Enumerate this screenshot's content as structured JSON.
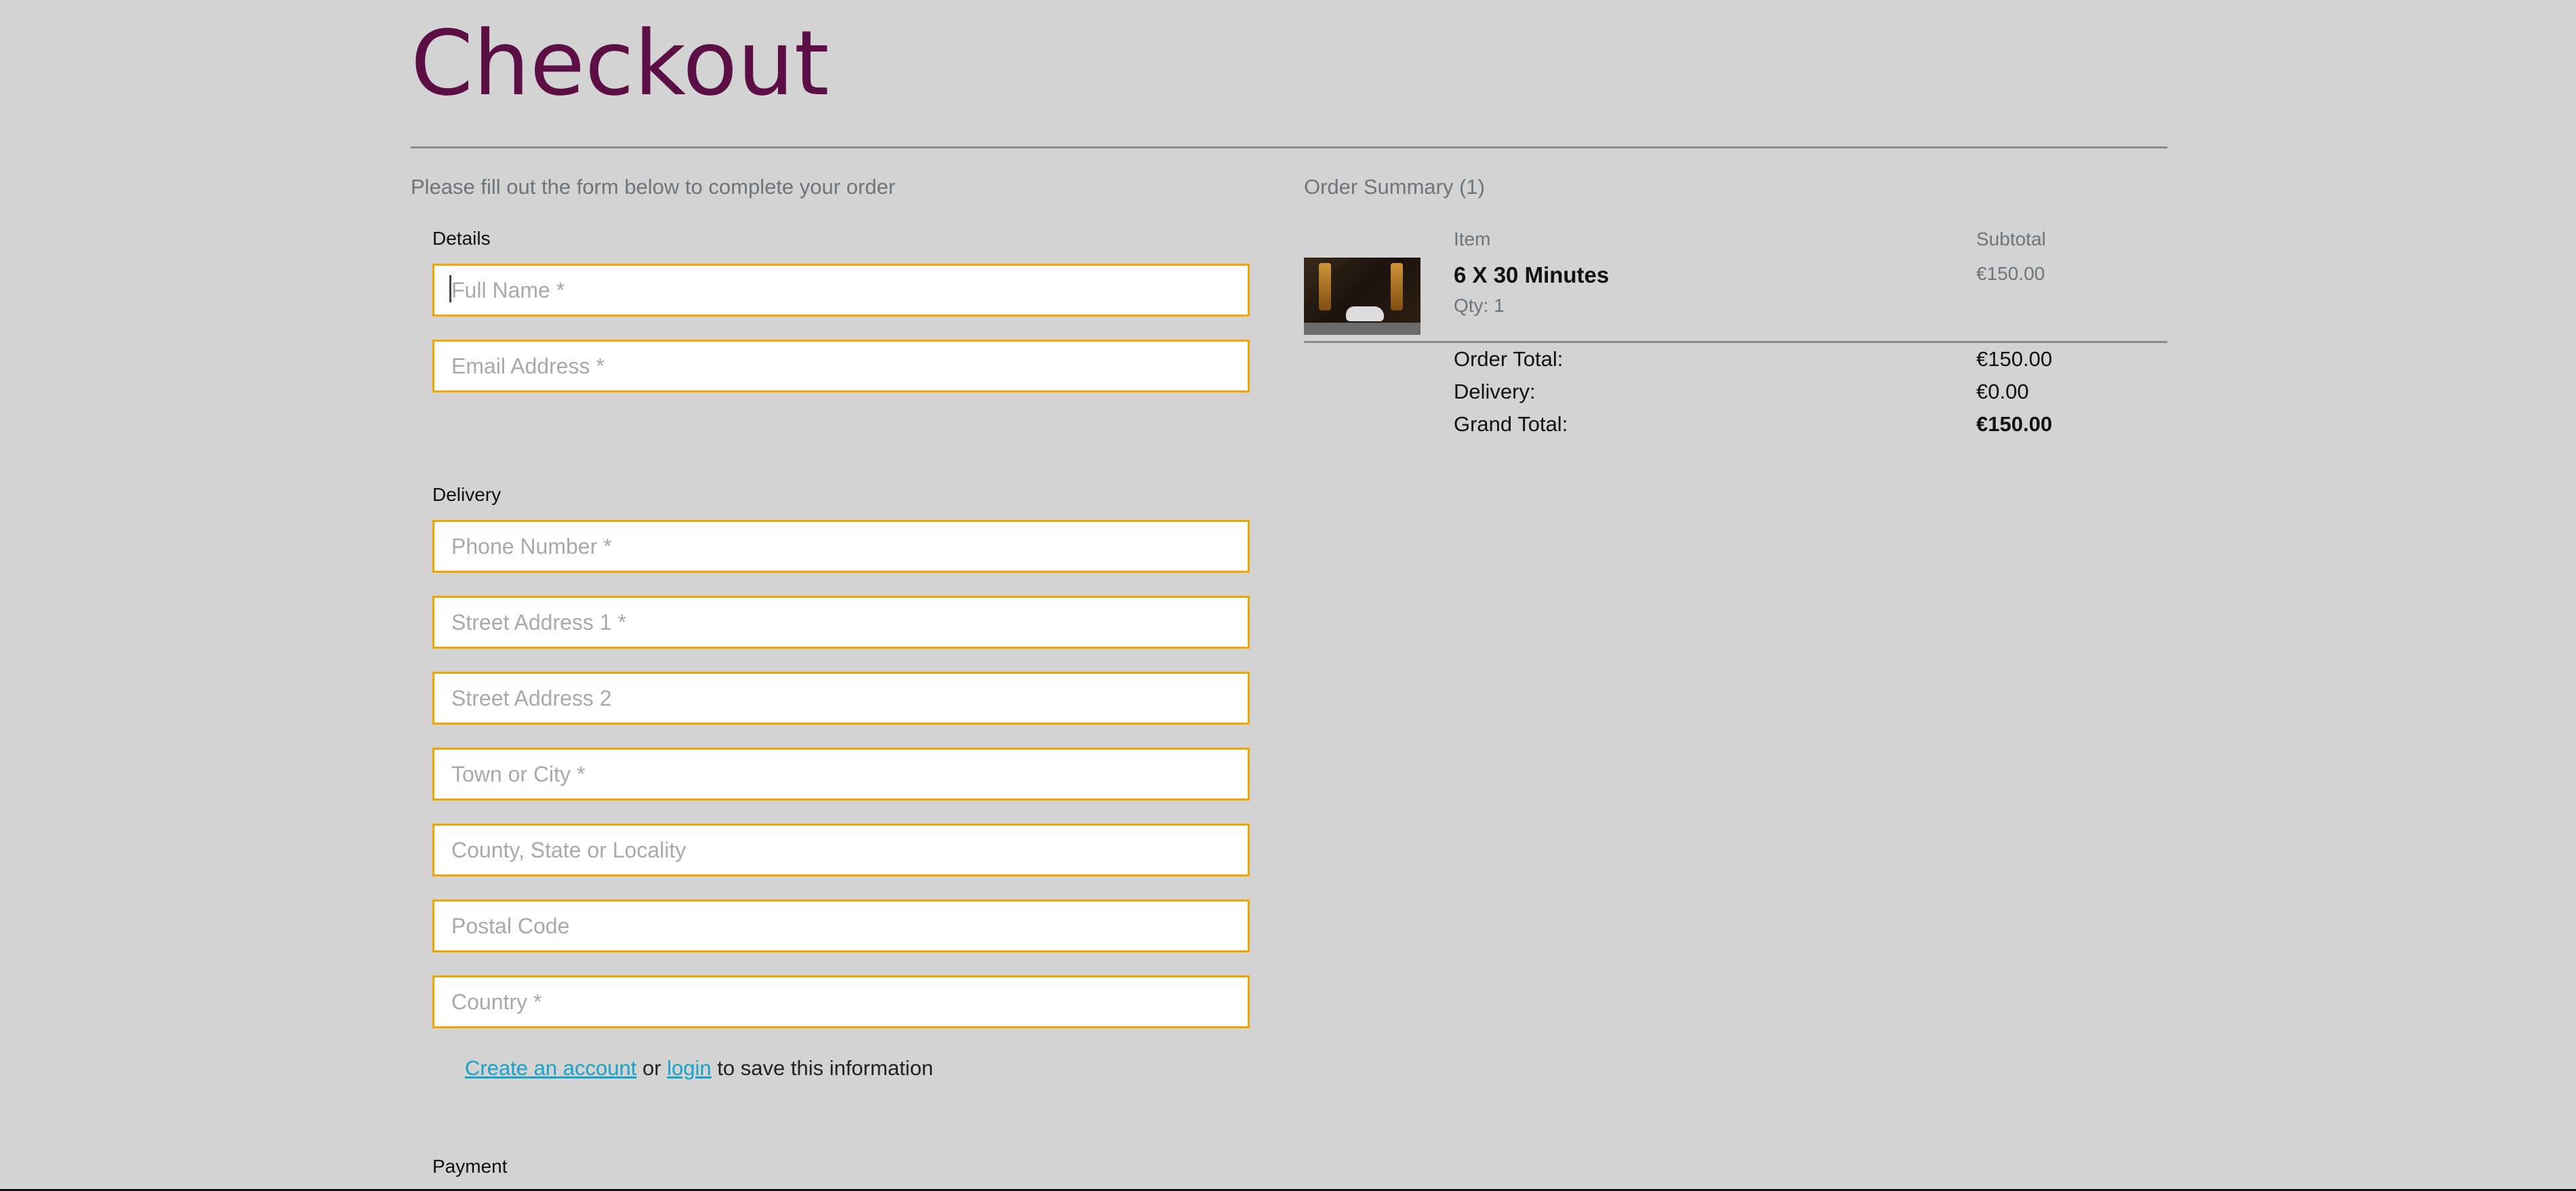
{
  "page": {
    "title": "Checkout",
    "intro": "Please fill out the form below to complete your order"
  },
  "form": {
    "details_label": "Details",
    "full_name_placeholder": "Full Name *",
    "email_placeholder": "Email Address *",
    "delivery_label": "Delivery",
    "phone_placeholder": "Phone Number *",
    "street1_placeholder": "Street Address 1 *",
    "street2_placeholder": "Street Address 2",
    "town_placeholder": "Town or City *",
    "county_placeholder": "County, State or Locality",
    "postcode_placeholder": "Postal Code",
    "country_placeholder": "Country *",
    "save_info": {
      "create_account_link": "Create an account",
      "or_text": "or",
      "login_link": "login",
      "suffix": "to save this information"
    },
    "payment_label": "Payment"
  },
  "summary": {
    "heading": "Order Summary (1)",
    "col_item": "Item",
    "col_subtotal": "Subtotal",
    "items": [
      {
        "name": "6 X 30 Minutes",
        "qty": "Qty: 1",
        "subtotal": "€150.00",
        "image": "shoe-lacing-photo"
      }
    ],
    "order_total_label": "Order Total:",
    "order_total_value": "€150.00",
    "delivery_label": "Delivery:",
    "delivery_value": "€0.00",
    "grand_total_label": "Grand Total:",
    "grand_total_value": "€150.00"
  },
  "colors": {
    "background": "#d3d3d3",
    "title": "#5c0f45",
    "field_border": "#f0a500",
    "link": "#17a2c8"
  }
}
